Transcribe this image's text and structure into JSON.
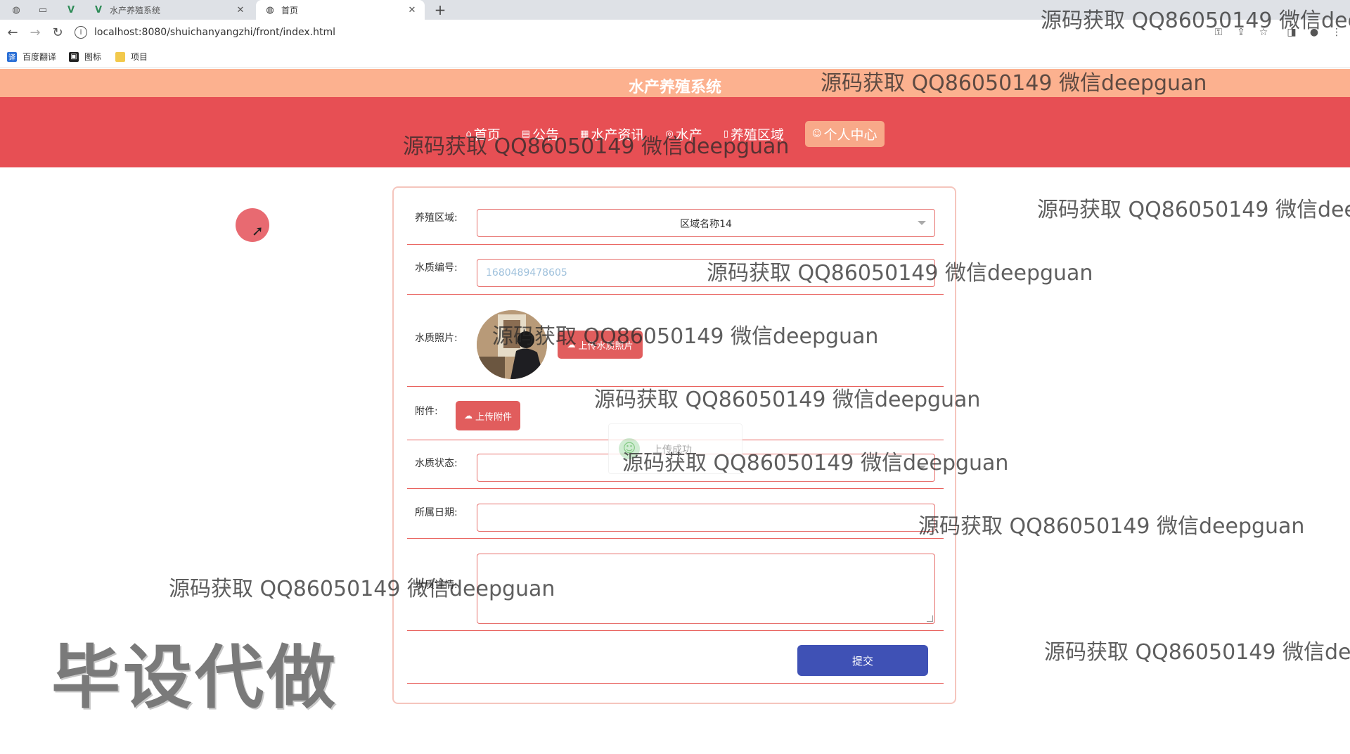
{
  "browser": {
    "tabs": [
      {
        "title": "水产养殖系统",
        "active": false
      },
      {
        "title": "首页",
        "active": true
      }
    ],
    "url": "localhost:8080/shuichanyangzhi/front/index.html",
    "bookmarks": [
      "百度翻译",
      "图标",
      "项目"
    ]
  },
  "header": {
    "site_title": "水产养殖系统",
    "menu": [
      {
        "label": "首页",
        "icon": "home-icon"
      },
      {
        "label": "公告",
        "icon": "notice-icon"
      },
      {
        "label": "水产资讯",
        "icon": "news-icon"
      },
      {
        "label": "水产",
        "icon": "fish-icon"
      },
      {
        "label": "养殖区域",
        "icon": "area-icon"
      },
      {
        "label": "个人中心",
        "icon": "user-icon",
        "active": true
      }
    ]
  },
  "form": {
    "area_label": "养殖区域:",
    "area_value": "区域名称14",
    "code_label": "水质编号:",
    "code_value": "1680489478605",
    "photo_label": "水质照片:",
    "upload_photo_btn": "上传水质照片",
    "attachment_label": "附件:",
    "upload_attachment_btn": "上传附件",
    "status_label": "水质状态:",
    "status_value": "",
    "date_label": "所属日期:",
    "date_value": "",
    "detail_label": "水质详情:",
    "detail_value": "",
    "submit_btn": "提交"
  },
  "toast": {
    "message": "上传成功"
  },
  "watermarks": {
    "text": "源码获取 QQ86050149 微信deepguan",
    "text_cut": "源码获取 QQ86050149 微信dee",
    "big": "毕设代做"
  },
  "colors": {
    "title_bar": "#fcb18f",
    "navbar": "#e74f54",
    "active_menu": "#f8a989",
    "primary_button": "#3f51b5",
    "upload_button": "#e15d5d",
    "field_border": "#e7706d"
  }
}
